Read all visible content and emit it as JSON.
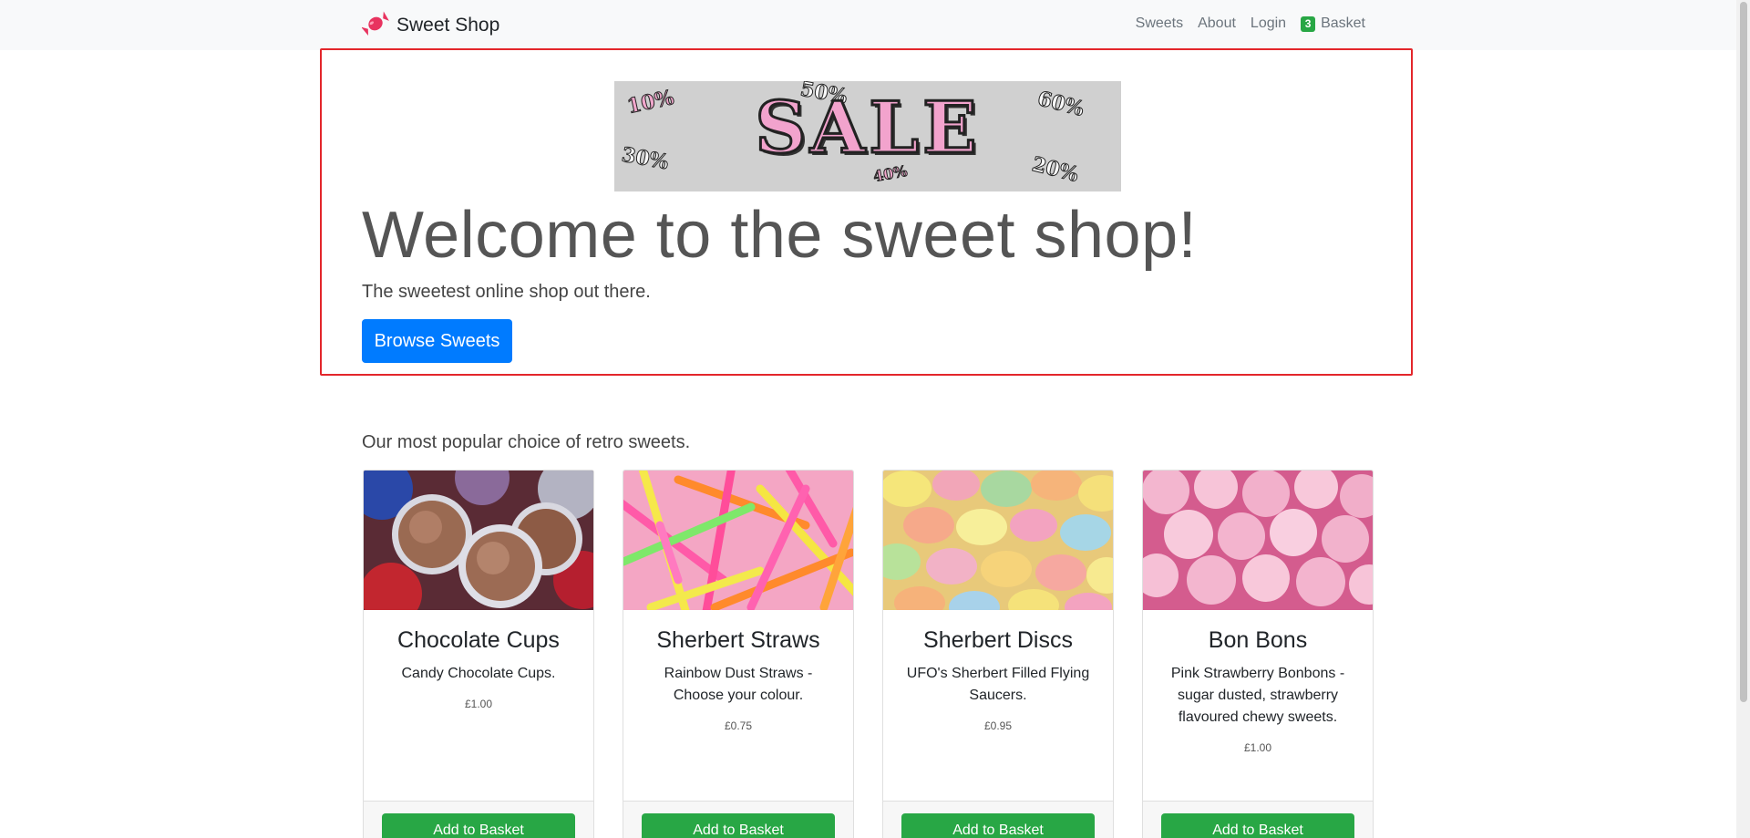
{
  "navbar": {
    "brand": "Sweet Shop",
    "links": [
      "Sweets",
      "About",
      "Login"
    ],
    "basket_count": "3",
    "basket_label": "Basket"
  },
  "hero": {
    "banner_word": "SALE",
    "banner_percents": [
      "10%",
      "50%",
      "60%",
      "30%",
      "40%",
      "20%"
    ],
    "title": "Welcome to the sweet shop!",
    "lead": "The sweetest online shop out there.",
    "button": "Browse Sweets"
  },
  "popular": {
    "heading": "Our most popular choice of retro sweets.",
    "products": [
      {
        "name": "Chocolate Cups",
        "description": "Candy Chocolate Cups.",
        "price": "£1.00",
        "button": "Add to Basket"
      },
      {
        "name": "Sherbert Straws",
        "description": "Rainbow Dust Straws - Choose your colour.",
        "price": "£0.75",
        "button": "Add to Basket"
      },
      {
        "name": "Sherbert Discs",
        "description": "UFO's Sherbert Filled Flying Saucers.",
        "price": "£0.95",
        "button": "Add to Basket"
      },
      {
        "name": "Bon Bons",
        "description": "Pink Strawberry Bonbons - sugar dusted, strawberry flavoured chewy sweets.",
        "price": "£1.00",
        "button": "Add to Basket"
      }
    ]
  },
  "colors": {
    "primary": "#007bff",
    "success": "#28a745",
    "highlight_border": "#e3262b",
    "navbar_bg": "#f8f9fa"
  }
}
